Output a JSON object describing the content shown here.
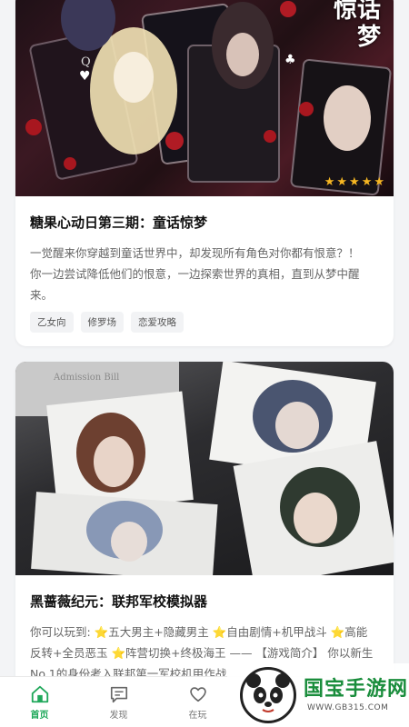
{
  "colors": {
    "accent": "#1fa85a",
    "star": "#f6b722",
    "watermark_green": "#1a8d3c"
  },
  "cards": [
    {
      "cover_text": "惊话梦",
      "rating_stars": 5,
      "title": "糖果心动日第三期：童话惊梦",
      "desc_line1": "一觉醒来你穿越到童话世界中，却发现所有角色对你都有恨意？！",
      "desc_line2": "你一边尝试降低他们的恨意，一边探索世界的真相，直到从梦中醒",
      "desc_line3": "来。",
      "tags": [
        "乙女向",
        "修罗场",
        "恋爱攻略"
      ]
    },
    {
      "cover_text": "Admission Bill",
      "title": "黑蔷薇纪元：联邦军校模拟器",
      "desc_line1": "你可以玩到: ⭐五大男主+隐藏男主 ⭐自由剧情+机甲战斗 ⭐高能",
      "desc_line2": "反转+全员恶玉 ⭐阵营切换+终极海王 —— 【游戏简介】 你以新生",
      "desc_line3": "No.1的身份考入联邦第一军校机甲作战"
    }
  ],
  "tabbar": [
    {
      "label": "首页",
      "icon": "home-icon",
      "active": true
    },
    {
      "label": "发现",
      "icon": "chat-icon",
      "active": false
    },
    {
      "label": "在玩",
      "icon": "heart-icon",
      "active": false
    }
  ],
  "watermark": {
    "title": "国宝手游网",
    "url": "WWW.GB315.COM"
  }
}
